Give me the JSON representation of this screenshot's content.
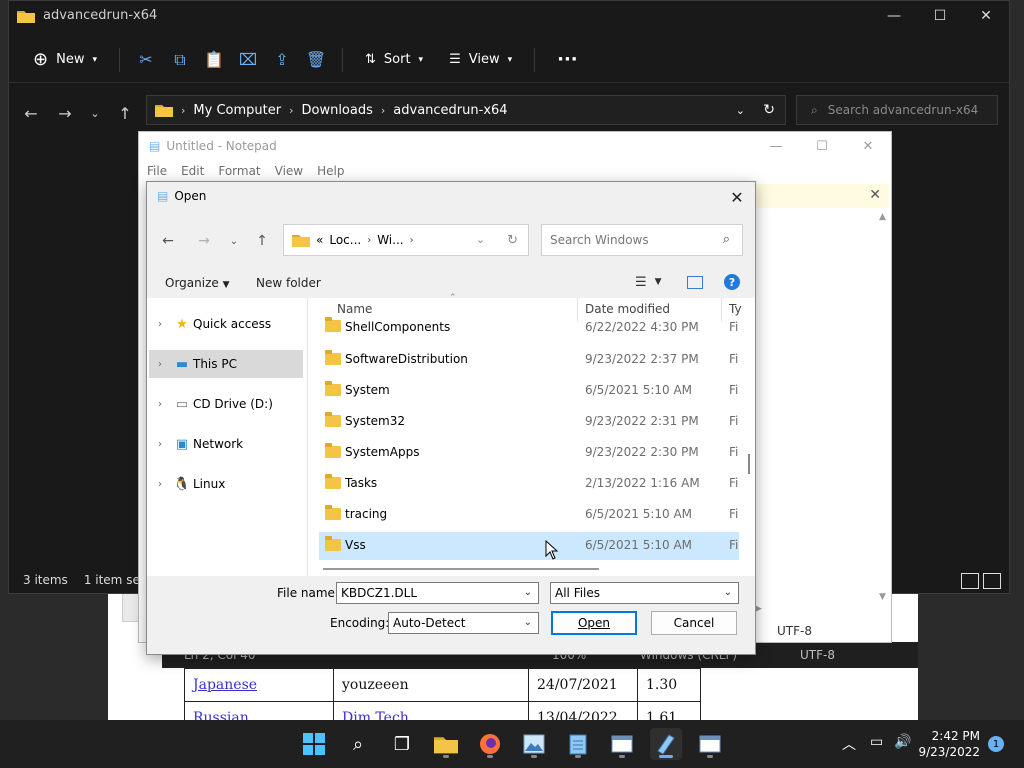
{
  "explorer": {
    "title": "advancedrun-x64",
    "toolbar": {
      "new_label": "New",
      "sort_label": "Sort",
      "view_label": "View"
    },
    "breadcrumb": [
      "My Computer",
      "Downloads",
      "advancedrun-x64"
    ],
    "search_placeholder": "Search advancedrun-x64",
    "status": {
      "items": "3 items",
      "selected": "1 item sele"
    }
  },
  "notepad": {
    "title": "Untitled - Notepad",
    "menu": [
      "File",
      "Edit",
      "Format",
      "View",
      "Help"
    ],
    "encoding": "UTF-8"
  },
  "background": {
    "status": {
      "position": "Ln 2, Col 40",
      "zoom": "100%",
      "line_ending": "Windows (CRLF)",
      "encoding": "UTF-8"
    },
    "table_rows": [
      [
        "Japanese",
        "youzeeen",
        "24/07/2021",
        "1.30"
      ],
      [
        "Russian",
        "Dim Tech",
        "13/04/2022",
        "1.61"
      ]
    ]
  },
  "dialog": {
    "title": "Open",
    "address": {
      "prefix": "«",
      "seg1": "Loc...",
      "seg2": "Wi..."
    },
    "search_placeholder": "Search Windows",
    "organize_label": "Organize",
    "new_folder_label": "New folder",
    "nav_items": [
      {
        "label": "Quick access",
        "icon": "star-icon"
      },
      {
        "label": "This PC",
        "icon": "monitor-icon"
      },
      {
        "label": "CD Drive (D:)",
        "icon": "drive-icon"
      },
      {
        "label": "Network",
        "icon": "network-icon"
      },
      {
        "label": "Linux",
        "icon": "penguin-icon"
      }
    ],
    "columns": [
      "Name",
      "Date modified",
      "Ty"
    ],
    "files": [
      {
        "name": "ShellComponents",
        "date": "6/22/2022 4:30 PM",
        "type": "Fi"
      },
      {
        "name": "SoftwareDistribution",
        "date": "9/23/2022 2:37 PM",
        "type": "Fi"
      },
      {
        "name": "System",
        "date": "6/5/2021 5:10 AM",
        "type": "Fi"
      },
      {
        "name": "System32",
        "date": "9/23/2022 2:31 PM",
        "type": "Fi"
      },
      {
        "name": "SystemApps",
        "date": "9/23/2022 2:30 PM",
        "type": "Fi"
      },
      {
        "name": "Tasks",
        "date": "2/13/2022 1:16 AM",
        "type": "Fi"
      },
      {
        "name": "tracing",
        "date": "6/5/2021 5:10 AM",
        "type": "Fi"
      },
      {
        "name": "Vss",
        "date": "6/5/2021 5:10 AM",
        "type": "Fi"
      }
    ],
    "file_name_label": "File name:",
    "file_name_value": "KBDCZ1.DLL",
    "filter_value": "All Files",
    "encoding_label": "Encoding:",
    "encoding_value": "Auto-Detect",
    "open_label": "Open",
    "cancel_label": "Cancel"
  },
  "taskbar": {
    "time": "2:42 PM",
    "date": "9/23/2022",
    "notification_count": "1"
  }
}
